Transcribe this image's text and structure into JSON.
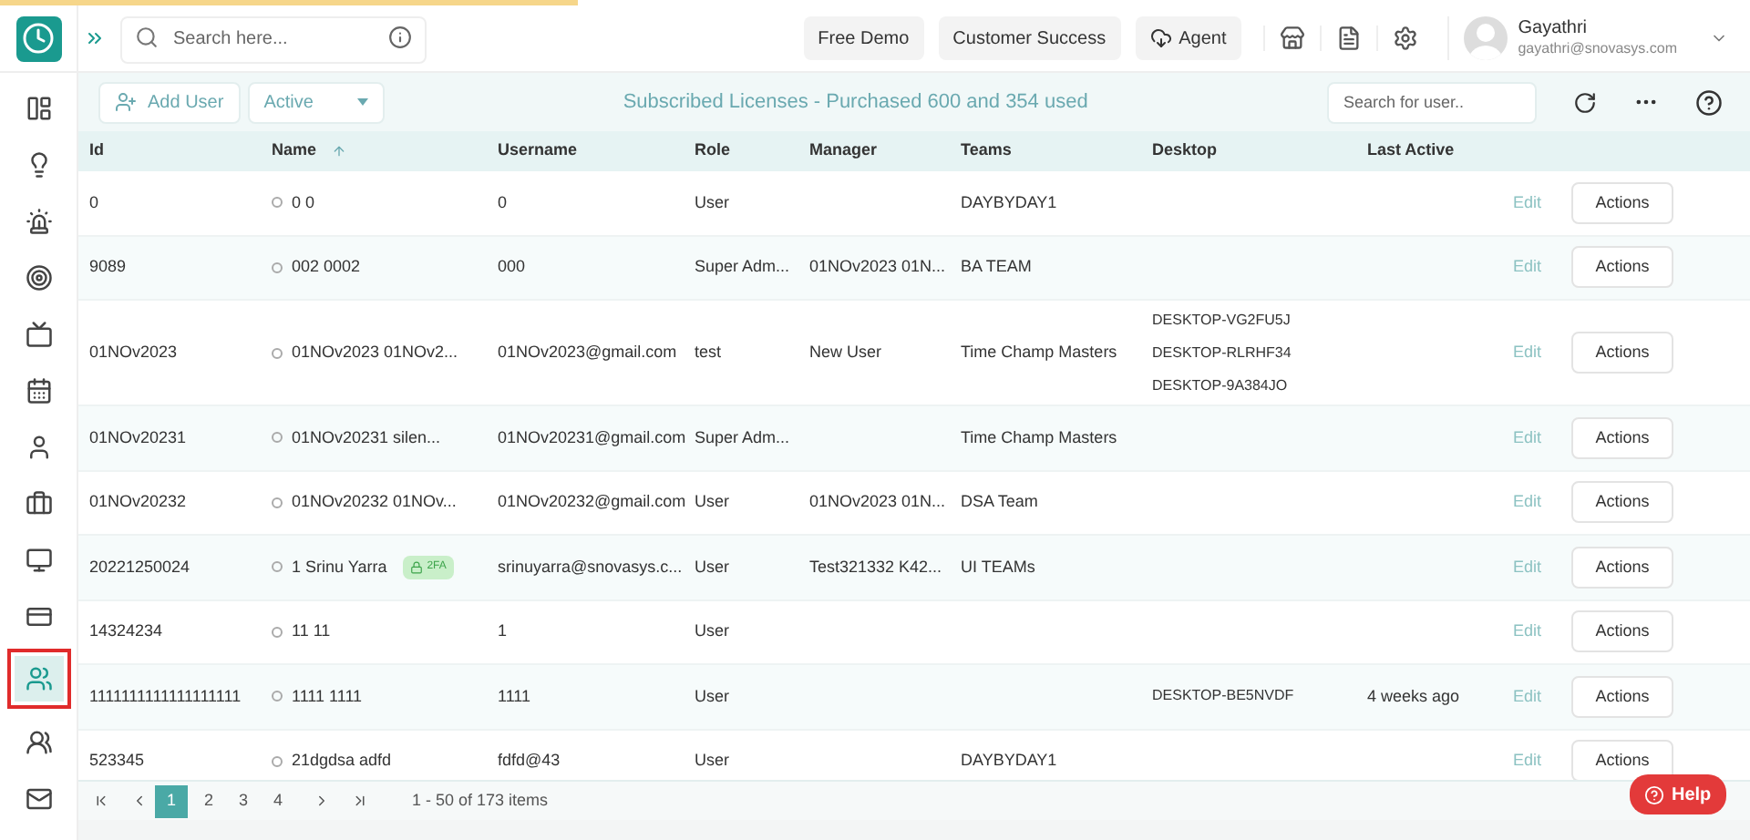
{
  "loading_bar": {
    "level": 0.33
  },
  "topbar": {
    "search": {
      "placeholder": "Search here..."
    },
    "buttons": [
      {
        "label": "Free Demo",
        "kind": "plain"
      },
      {
        "label": "Customer Success",
        "kind": "plain"
      },
      {
        "label": "Agent",
        "kind": "cloud"
      }
    ],
    "user": {
      "name": "Gayathri",
      "email": "gayathri@snovasys.com"
    }
  },
  "sidebar": {
    "items": [
      {
        "kind": "dashboard",
        "selected": false
      },
      {
        "kind": "idea",
        "selected": false
      },
      {
        "kind": "alert",
        "selected": false
      },
      {
        "kind": "target",
        "selected": false
      },
      {
        "kind": "tv",
        "selected": false
      },
      {
        "kind": "calendar",
        "selected": false
      },
      {
        "kind": "user",
        "selected": false
      },
      {
        "kind": "briefcase",
        "selected": false
      },
      {
        "kind": "monitor",
        "selected": false
      },
      {
        "kind": "card",
        "selected": false
      },
      {
        "kind": "users",
        "selected": true
      },
      {
        "kind": "team",
        "selected": false
      },
      {
        "kind": "mail",
        "selected": false
      }
    ]
  },
  "toolbar": {
    "add_user": "Add User",
    "status_filter": "Active",
    "license_info": "Subscribed Licenses - Purchased 600 and 354 used",
    "user_search": {
      "placeholder": "Search for user.."
    }
  },
  "table": {
    "columns": [
      {
        "label": "Id",
        "sorted": false
      },
      {
        "label": "Name",
        "sorted": true
      },
      {
        "label": "Username",
        "sorted": false
      },
      {
        "label": "Role",
        "sorted": false
      },
      {
        "label": "Manager",
        "sorted": false
      },
      {
        "label": "Teams",
        "sorted": false
      },
      {
        "label": "Desktop",
        "sorted": false
      },
      {
        "label": "Last Active",
        "sorted": false
      }
    ],
    "rows": [
      {
        "id": "0",
        "name": "0 0",
        "badge": "",
        "username": "0",
        "role": "User",
        "manager": "",
        "teams": "DAYBYDAY1",
        "desktops": [],
        "last_active": "",
        "edit": "Edit",
        "actions": "Actions"
      },
      {
        "id": "9089",
        "name": "002 0002",
        "badge": "",
        "username": "000",
        "role": "Super Adm...",
        "manager": "01NOv2023 01N...",
        "teams": "BA TEAM",
        "desktops": [],
        "last_active": "",
        "edit": "Edit",
        "actions": "Actions"
      },
      {
        "id": "01NOv2023",
        "name": "01NOv2023 01NOv2...",
        "badge": "",
        "username": "01NOv2023@gmail.com",
        "role": "test",
        "manager": "New User",
        "teams": "Time Champ Masters",
        "desktops": [
          "DESKTOP-VG2FU5J",
          "DESKTOP-RLRHF34",
          "DESKTOP-9A384JO"
        ],
        "last_active": "",
        "edit": "Edit",
        "actions": "Actions"
      },
      {
        "id": "01NOv20231",
        "name": "01NOv20231 silen...",
        "badge": "",
        "username": "01NOv20231@gmail.com",
        "role": "Super Adm...",
        "manager": "",
        "teams": "Time Champ Masters",
        "desktops": [],
        "last_active": "",
        "edit": "Edit",
        "actions": "Actions"
      },
      {
        "id": "01NOv20232",
        "name": "01NOv20232 01NOv...",
        "badge": "",
        "username": "01NOv20232@gmail.com",
        "role": "User",
        "manager": "01NOv2023 01N...",
        "teams": "DSA Team",
        "desktops": [],
        "last_active": "",
        "edit": "Edit",
        "actions": "Actions"
      },
      {
        "id": "20221250024",
        "name": "1 Srinu Yarra",
        "badge": "2FA",
        "username": "srinuyarra@snovasys.c...",
        "role": "User",
        "manager": "Test321332 K42...",
        "teams": "UI TEAMs",
        "desktops": [],
        "last_active": "",
        "edit": "Edit",
        "actions": "Actions"
      },
      {
        "id": "14324234",
        "name": "11 11",
        "badge": "",
        "username": "1",
        "role": "User",
        "manager": "",
        "teams": "",
        "desktops": [],
        "last_active": "",
        "edit": "Edit",
        "actions": "Actions"
      },
      {
        "id": "1111111111111111111",
        "name": "1111 1111",
        "badge": "",
        "username": "1111",
        "role": "User",
        "manager": "",
        "teams": "",
        "desktops": [
          "DESKTOP-BE5NVDF"
        ],
        "last_active": "4 weeks ago",
        "edit": "Edit",
        "actions": "Actions"
      },
      {
        "id": "523345",
        "name": "21dgdsa adfd",
        "badge": "",
        "username": "fdfd@43",
        "role": "User",
        "manager": "",
        "teams": "DAYBYDAY1",
        "desktops": [],
        "last_active": "",
        "edit": "Edit",
        "actions": "Actions"
      }
    ]
  },
  "pagination": {
    "pages": [
      {
        "label": "1",
        "selected": true
      },
      {
        "label": "2",
        "selected": false
      },
      {
        "label": "3",
        "selected": false
      },
      {
        "label": "4",
        "selected": false
      }
    ],
    "summary": "1 - 50 of 173 items"
  },
  "help_button": "Help"
}
